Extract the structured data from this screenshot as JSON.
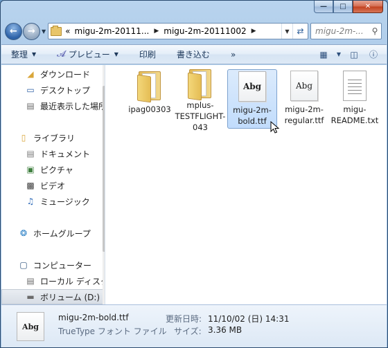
{
  "window": {
    "minimize_glyph": "—",
    "maximize_glyph": "□",
    "close_glyph": "✕"
  },
  "address": {
    "prefix": "«",
    "crumbs": [
      "migu-2m-20111...",
      "migu-2m-20111002"
    ],
    "search_placeholder": "migu-2m-..."
  },
  "toolbar": {
    "organize_label": "整理",
    "preview_label": "プレビュー",
    "print_label": "印刷",
    "burn_label": "書き込む",
    "more_label": "»"
  },
  "nav": {
    "items": [
      {
        "label": "ダウンロード",
        "icon": "download-folder-icon"
      },
      {
        "label": "デスクトップ",
        "icon": "desktop-icon"
      },
      {
        "label": "最近表示した場所",
        "icon": "recent-places-icon"
      },
      {
        "label": "ライブラリ",
        "icon": "libraries-icon"
      },
      {
        "label": "ドキュメント",
        "icon": "documents-icon"
      },
      {
        "label": "ピクチャ",
        "icon": "pictures-icon"
      },
      {
        "label": "ビデオ",
        "icon": "videos-icon"
      },
      {
        "label": "ミュージック",
        "icon": "music-icon"
      },
      {
        "label": "ホームグループ",
        "icon": "homegroup-icon"
      },
      {
        "label": "コンピューター",
        "icon": "computer-icon"
      },
      {
        "label": "ローカル ディスク",
        "icon": "local-disk-icon"
      },
      {
        "label": "ボリューム (D:)",
        "icon": "volume-drive-icon"
      }
    ]
  },
  "files": [
    {
      "name": "ipag00303",
      "type": "folder"
    },
    {
      "name": "mplus-TESTFLIGHT-043",
      "type": "folder"
    },
    {
      "name": "migu-2m-bold.ttf",
      "type": "font-bold",
      "preview": "Abg"
    },
    {
      "name": "migu-2m-regular.ttf",
      "type": "font",
      "preview": "Abg"
    },
    {
      "name": "migu-README.txt",
      "type": "text"
    }
  ],
  "details": {
    "preview": "Abg",
    "name": "migu-2m-bold.ttf",
    "type": "TrueType フォント ファイル",
    "modified_label": "更新日時:",
    "modified_value": "11/10/02 (日) 14:31",
    "size_label": "サイズ:",
    "size_value": "3.36 MB"
  }
}
